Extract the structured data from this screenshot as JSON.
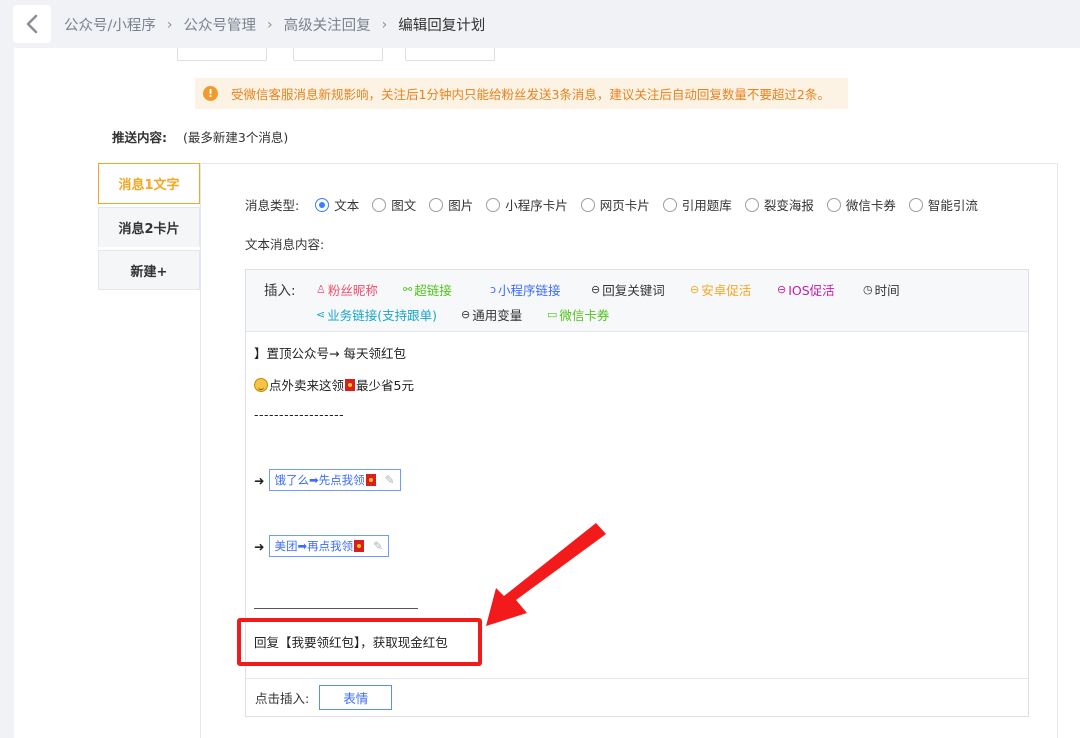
{
  "header": {
    "back_icon": "chevron-left-icon",
    "breadcrumb": [
      "公众号/小程序",
      "公众号管理",
      "高级关注回复",
      "编辑回复计划"
    ]
  },
  "notice": {
    "icon": "warning-icon",
    "text": "受微信客服消息新规影响，关注后1分钟内只能给粉丝发送3条消息，建议关注后自动回复数量不要超过2条。"
  },
  "push_content": {
    "label": "推送内容:",
    "hint": "(最多新建3个消息)"
  },
  "message_tabs": [
    {
      "label": "消息1文字",
      "active": true
    },
    {
      "label": "消息2卡片",
      "active": false
    },
    {
      "label": "新建+",
      "active": false
    }
  ],
  "message_type": {
    "label": "消息类型:",
    "options": [
      "文本",
      "图文",
      "图片",
      "小程序卡片",
      "网页卡片",
      "引用题库",
      "裂变海报",
      "微信卡券",
      "智能引流"
    ],
    "selected": "文本"
  },
  "text_content_label": "文本消息内容:",
  "insert": {
    "label": "插入:",
    "items": [
      {
        "label": "粉丝昵称",
        "color": "#f0506e",
        "icon": "user-icon"
      },
      {
        "label": "超链接",
        "color": "#52c41a",
        "icon": "link-icon"
      },
      {
        "label": "小程序链接",
        "color": "#3b6cff",
        "icon": "mini-program-icon"
      },
      {
        "label": "回复关键词",
        "color": "#333333",
        "icon": "circle-minus-icon"
      },
      {
        "label": "安卓促活",
        "color": "#f5a623",
        "icon": "circle-minus-icon"
      },
      {
        "label": "IOS促活",
        "color": "#c21fa8",
        "icon": "circle-minus-icon"
      },
      {
        "label": "时间",
        "color": "#333333",
        "icon": "clock-icon"
      },
      {
        "label": "业务链接(支持跟单)",
        "color": "#1aa6c9",
        "icon": "share-icon"
      },
      {
        "label": "通用变量",
        "color": "#333333",
        "icon": "circle-minus-icon"
      },
      {
        "label": "微信卡券",
        "color": "#52c41a",
        "icon": "card-icon"
      }
    ]
  },
  "body": {
    "line1": "】置顶公众号→ 每天领红包",
    "line2_a": "点外卖来这领",
    "line2_b": "最少省5元",
    "dashes": "------------------",
    "arrow": "➜",
    "link1": "饿了么➡先点我领",
    "link2": "美团➡再点我领",
    "reply": "回复【我要领红包】，获取现金红包"
  },
  "click_insert": {
    "label": "点击插入:",
    "button": "表情"
  },
  "annotation": {
    "color": "#f21a1a"
  }
}
